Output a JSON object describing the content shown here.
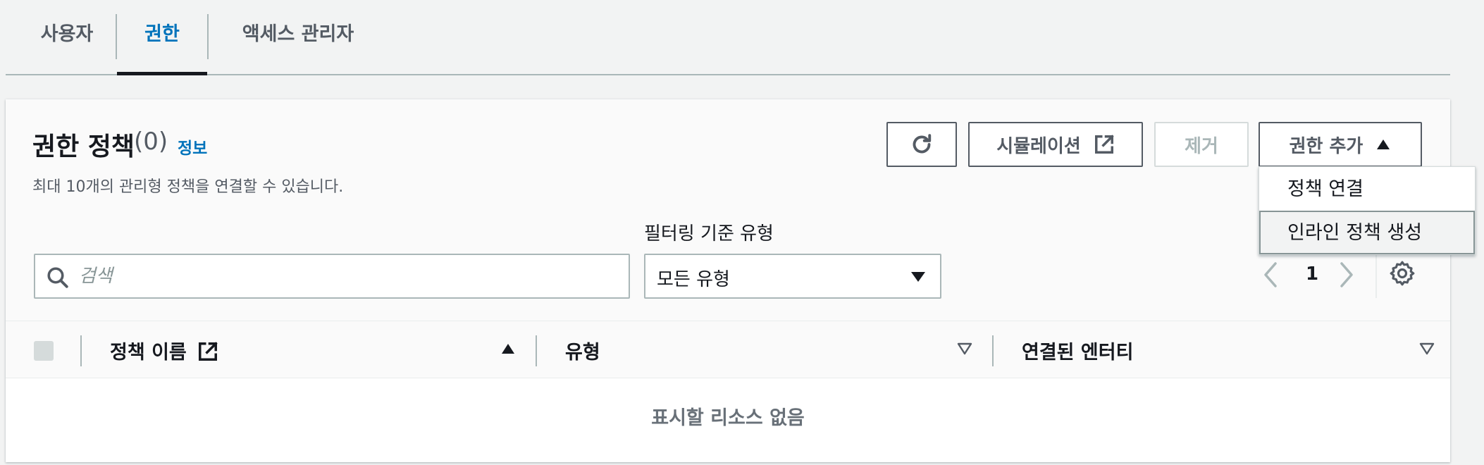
{
  "tabs": [
    {
      "label": "사용자"
    },
    {
      "label": "권한"
    },
    {
      "label": "액세스 관리자"
    }
  ],
  "panel": {
    "title": "권한 정책",
    "count": "(0)",
    "info_link": "정보",
    "description": "최대 10개의 관리형 정책을 연결할 수 있습니다."
  },
  "toolbar": {
    "simulation_label": "시뮬레이션",
    "remove_label": "제거",
    "add_permissions_label": "권한 추가"
  },
  "dropdown": {
    "items": [
      {
        "label": "정책 연결"
      },
      {
        "label": "인라인 정책 생성"
      }
    ]
  },
  "filter": {
    "search_placeholder": "검색",
    "type_label": "필터링 기준 유형",
    "type_value": "모든 유형"
  },
  "pagination": {
    "current_page": "1"
  },
  "table": {
    "columns": [
      {
        "label": "정책 이름"
      },
      {
        "label": "유형"
      },
      {
        "label": "연결된 엔터티"
      }
    ],
    "empty_message": "표시할 리소스 없음"
  },
  "colors": {
    "accent": "#0073bb",
    "text": "#16191f",
    "muted": "#545b64",
    "border": "#aab7b8"
  }
}
